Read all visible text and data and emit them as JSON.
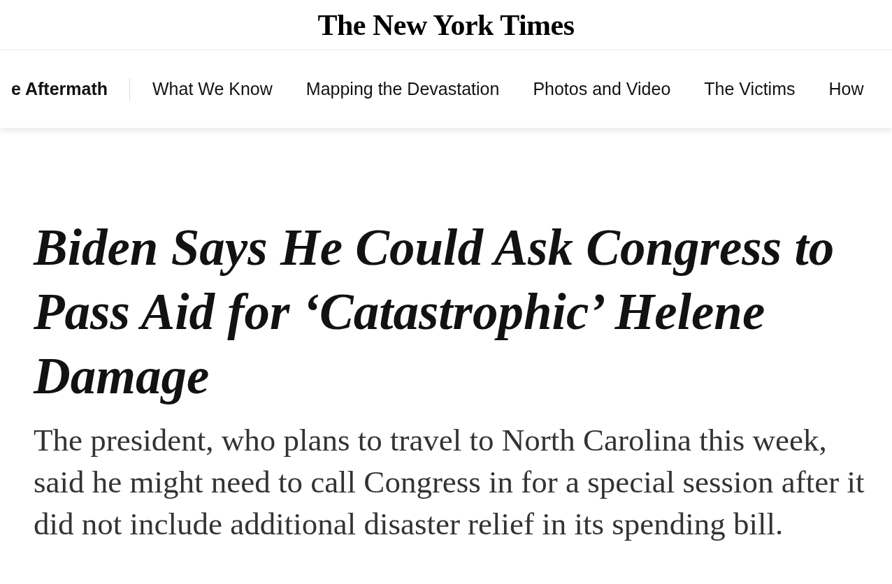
{
  "masthead": {
    "title": "The New York Times"
  },
  "nav": {
    "section": "e Aftermath",
    "links": [
      "What We Know",
      "Mapping the Devastation",
      "Photos and Video",
      "The Victims",
      "How"
    ]
  },
  "article": {
    "headline": "Biden Says He Could Ask Congress to Pass Aid for ‘Catastrophic’ Helene Damage",
    "summary": "The president, who plans to travel to North Carolina this week, said he might need to call Congress in for a special session after it did not include additional disaster relief in its spending bill."
  }
}
